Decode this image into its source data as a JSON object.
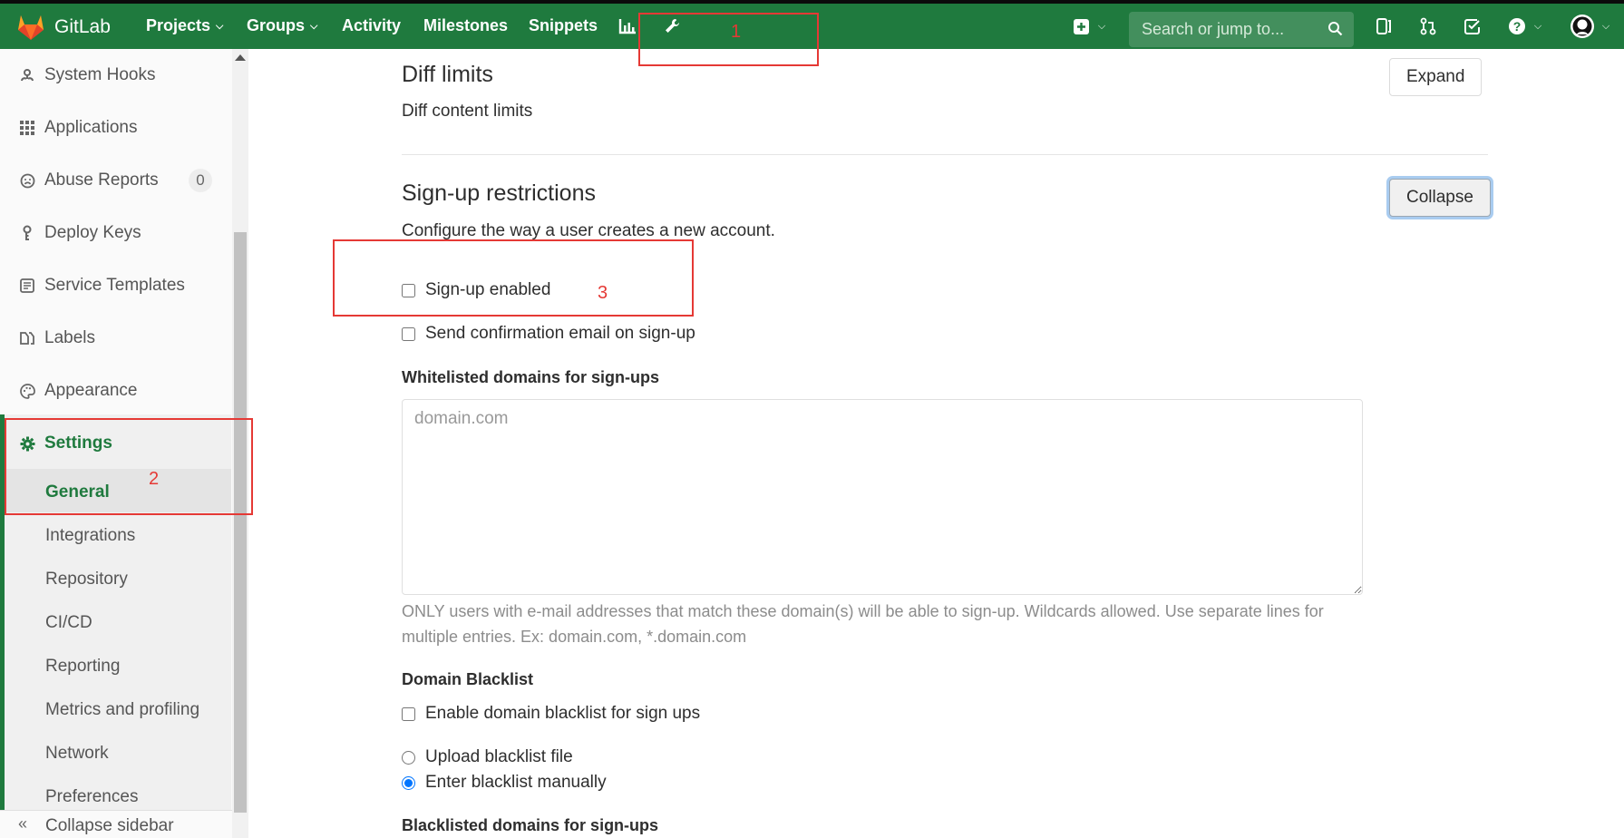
{
  "topbar": {
    "brand": "GitLab",
    "nav": [
      {
        "label": "Projects",
        "dropdown": true
      },
      {
        "label": "Groups",
        "dropdown": true
      },
      {
        "label": "Activity",
        "dropdown": false
      },
      {
        "label": "Milestones",
        "dropdown": false
      },
      {
        "label": "Snippets",
        "dropdown": false
      }
    ],
    "search_placeholder": "Search or jump to...",
    "icons": [
      "chart-icon",
      "wrench-icon",
      "plus-square-icon",
      "issues-icon",
      "merge-request-icon",
      "todo-icon",
      "help-icon",
      "avatar-github-icon"
    ]
  },
  "annotations": {
    "one": "1",
    "two": "2",
    "three": "3",
    "color": "#e53935"
  },
  "sidebar": {
    "items": [
      {
        "label": "System Hooks",
        "icon": "hook-icon"
      },
      {
        "label": "Applications",
        "icon": "grid-icon"
      },
      {
        "label": "Abuse Reports",
        "icon": "frown-icon",
        "badge": "0"
      },
      {
        "label": "Deploy Keys",
        "icon": "key-icon"
      },
      {
        "label": "Service Templates",
        "icon": "template-icon"
      },
      {
        "label": "Labels",
        "icon": "labels-icon"
      },
      {
        "label": "Appearance",
        "icon": "palette-icon"
      }
    ],
    "settings": {
      "label": "Settings",
      "sub": [
        "General",
        "Integrations",
        "Repository",
        "CI/CD",
        "Reporting",
        "Metrics and profiling",
        "Network",
        "Preferences"
      ]
    },
    "collapse_label": "Collapse sidebar",
    "accent": "#1f7a3e"
  },
  "main": {
    "diff": {
      "title": "Diff limits",
      "desc": "Diff content limits",
      "button": "Expand"
    },
    "signup": {
      "title": "Sign-up restrictions",
      "desc": "Configure the way a user creates a new account.",
      "button": "Collapse",
      "signup_enabled": "Sign-up enabled",
      "send_confirmation": "Send confirmation email on sign-up",
      "whitelist_label": "Whitelisted domains for sign-ups",
      "whitelist_placeholder": "domain.com",
      "whitelist_help": "ONLY users with e-mail addresses that match these domain(s) will be able to sign-up. Wildcards allowed. Use separate lines for multiple entries. Ex: domain.com, *.domain.com",
      "blacklist_label": "Domain Blacklist",
      "enable_blacklist": "Enable domain blacklist for sign ups",
      "upload_blacklist": "Upload blacklist file",
      "enter_blacklist": "Enter blacklist manually",
      "blacklisted_label": "Blacklisted domains for sign-ups"
    }
  }
}
